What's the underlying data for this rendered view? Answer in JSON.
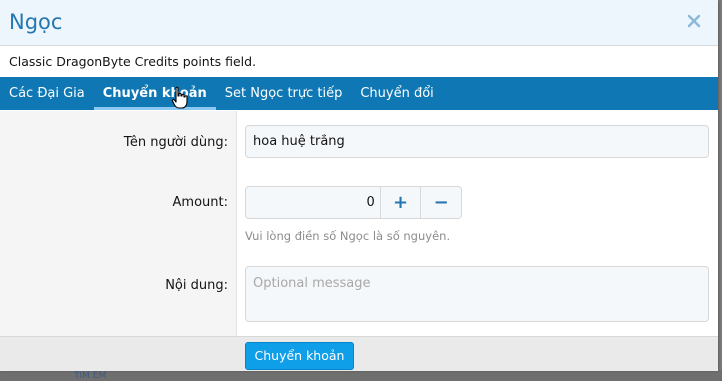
{
  "overlay": {
    "title": "Ngọc",
    "description": "Classic DragonByte Credits points field."
  },
  "tabs": [
    {
      "label": "Các Đại Gia",
      "active": false
    },
    {
      "label": "Chuyển khoản",
      "active": true
    },
    {
      "label": "Set Ngọc trực tiếp",
      "active": false
    },
    {
      "label": "Chuyển đổi",
      "active": false
    }
  ],
  "form": {
    "username_label": "Tên người dùng:",
    "username_value": "hoa huệ trắng",
    "amount_label": "Amount:",
    "amount_value": "0",
    "plus_label": "+",
    "minus_label": "−",
    "amount_hint": "Vui lòng điền số Ngọc là số nguyên.",
    "message_label": "Nội dung:",
    "message_placeholder": "Optional message",
    "submit_label": "Chuyển khoản"
  },
  "background": {
    "partial_text": "TIM EM"
  },
  "colors": {
    "accent": "#0f78b4",
    "title": "#2577b1",
    "button": "#0f9ee8"
  }
}
